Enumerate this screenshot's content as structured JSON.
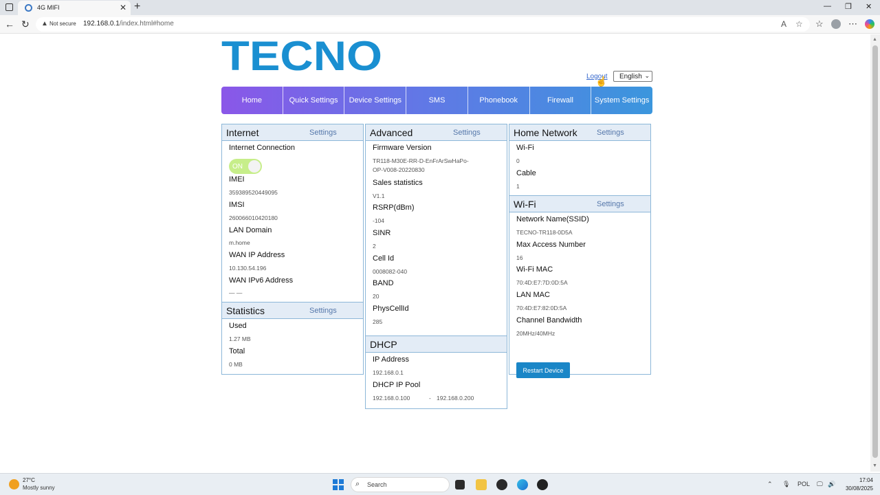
{
  "browser": {
    "tab_title": "4G MIFI",
    "security_label": "Not secure",
    "url_host": "192.168.0.1",
    "url_path": "/index.html#home"
  },
  "header": {
    "logo_text": "TECNO",
    "logout_label": "Logout",
    "language_selected": "English"
  },
  "nav": {
    "items": [
      "Home",
      "Quick Settings",
      "Device Settings",
      "SMS",
      "Phonebook",
      "Firewall",
      "System Settings"
    ]
  },
  "internet": {
    "title": "Internet",
    "settings_label": "Settings",
    "connection_label": "Internet Connection",
    "toggle_label": "ON",
    "imei_label": "IMEI",
    "imei": "359389520449095",
    "imsi_label": "IMSI",
    "imsi": "260066010420180",
    "lan_domain_label": "LAN Domain",
    "lan_domain": "m.home",
    "wan_ip_label": "WAN IP Address",
    "wan_ip": "10.130.54.196",
    "wan_ipv6_label": "WAN IPv6 Address",
    "wan_ipv6": "— —"
  },
  "statistics": {
    "title": "Statistics",
    "settings_label": "Settings",
    "used_label": "Used",
    "used": "1.27 MB",
    "total_label": "Total",
    "total": "0 MB"
  },
  "advanced": {
    "title": "Advanced",
    "settings_label": "Settings",
    "firmware_label": "Firmware Version",
    "firmware_line1": "TR118-M30E-RR-D-EnFrArSwHaPo-",
    "firmware_line2": "OP-V008-20220830",
    "sales_label": "Sales statistics",
    "sales": "V1.1",
    "rsrp_label": "RSRP(dBm)",
    "rsrp": "-104",
    "sinr_label": "SINR",
    "sinr": "2",
    "cell_label": "Cell Id",
    "cell": "0008082-040",
    "band_label": "BAND",
    "band": "20",
    "phys_label": "PhysCellId",
    "phys": "285"
  },
  "dhcp": {
    "title": "DHCP",
    "ip_label": "IP Address",
    "ip": "192.168.0.1",
    "pool_label": "DHCP IP Pool",
    "pool_start": "192.168.0.100",
    "pool_sep": "-",
    "pool_end": "192.168.0.200"
  },
  "home_network": {
    "title": "Home Network",
    "settings_label": "Settings",
    "wifi_label": "Wi-Fi",
    "wifi": "0",
    "cable_label": "Cable",
    "cable": "1"
  },
  "wifi": {
    "title": "Wi-Fi",
    "settings_label": "Settings",
    "ssid_label": "Network Name(SSID)",
    "ssid": "TECNO-TR118-0D5A",
    "max_label": "Max Access Number",
    "max": "16",
    "wifi_mac_label": "Wi-Fi MAC",
    "wifi_mac": "70:4D:E7:7D:0D:5A",
    "lan_mac_label": "LAN MAC",
    "lan_mac": "70:4D:E7:82:0D:5A",
    "bw_label": "Channel Bandwidth",
    "bw": "20MHz/40MHz",
    "restart_label": "Restart Device"
  },
  "taskbar": {
    "temperature": "27°C",
    "weather": "Mostly sunny",
    "search_placeholder": "Search",
    "lang_indicator": "POL",
    "time": "17:04",
    "date": "30/08/2025"
  },
  "colors": {
    "nav_gradient_start": "#8a57e8",
    "nav_gradient_end": "#3b96dd",
    "logo_blue": "#1a8fd1",
    "panel_header_bg": "#e3ecf6",
    "panel_border": "#8cb7d8",
    "toggle_on": "#c7ee8a",
    "restart_button": "#1a86c7"
  }
}
